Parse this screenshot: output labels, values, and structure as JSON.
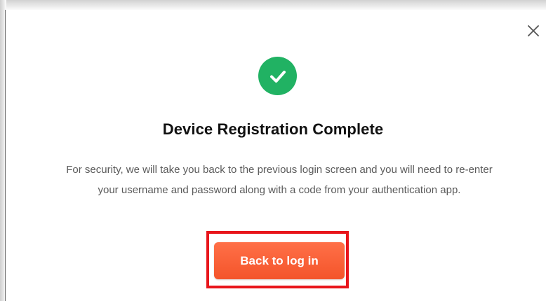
{
  "dialog": {
    "title": "Device Registration Complete",
    "message": "For security, we will take you back to the previous login screen and you will need to re-enter your username and password along with a code from your authentication app.",
    "primary_button_label": "Back to log in",
    "close_icon": "close-icon",
    "status_icon": "check-circle-icon"
  },
  "colors": {
    "success": "#21b263",
    "primary_button": "#f4542a",
    "highlight_border": "#e8151b",
    "title_text": "#111111",
    "body_text": "#5a5a5a"
  }
}
